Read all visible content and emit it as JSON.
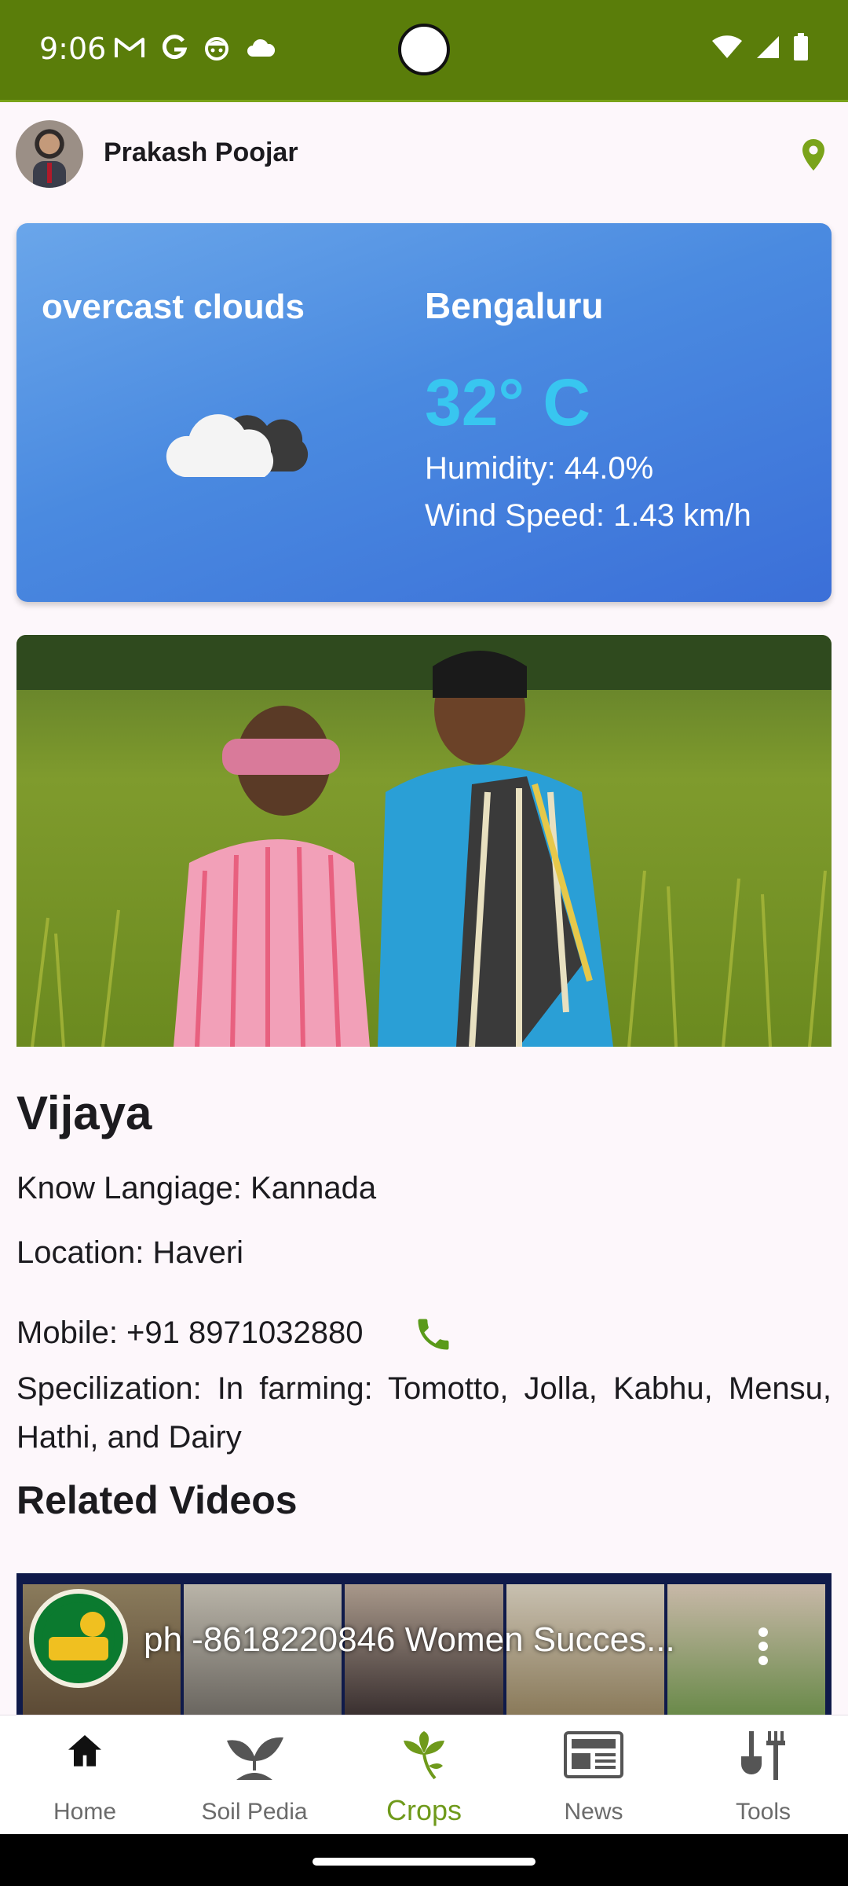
{
  "status_bar": {
    "time": "9:06",
    "left_icons": [
      "gmail-icon",
      "google-icon",
      "face-icon",
      "cloud-icon"
    ],
    "right_icons": [
      "wifi-icon",
      "signal-icon",
      "battery-icon"
    ]
  },
  "header": {
    "user_name": "Prakash Poojar",
    "location_icon": "location-pin-icon"
  },
  "weather": {
    "description": "overcast clouds",
    "city": "Bengaluru",
    "temperature": "32° C",
    "humidity": "Humidity: 44.0%",
    "wind_speed": "Wind Speed: 1.43 km/h",
    "icon": "cloud-icon"
  },
  "profile": {
    "name": "Vijaya",
    "language": "Know Langiage: Kannada",
    "location": "Location: Haveri",
    "mobile": "Mobile: +91 8971032880",
    "specialization": "Specilization: In farming: Tomotto, Jolla, Kabhu, Mensu, Hathi, and Dairy"
  },
  "related_videos": {
    "title": "Related Videos",
    "videos": [
      {
        "title": "ph -8618220846 Women Succes..."
      }
    ]
  },
  "bottom_nav": {
    "items": [
      {
        "label": "Home",
        "icon": "home-icon",
        "active": false
      },
      {
        "label": "Soil Pedia",
        "icon": "sprout-icon",
        "active": false
      },
      {
        "label": "Crops",
        "icon": "crops-icon",
        "active": true
      },
      {
        "label": "News",
        "icon": "newspaper-icon",
        "active": false
      },
      {
        "label": "Tools",
        "icon": "tools-icon",
        "active": false
      }
    ]
  },
  "colors": {
    "status_bar": "#5a7d0a",
    "accent_green": "#6f9a1b",
    "temperature": "#38c6f0",
    "weather_card_start": "#6aa6ea",
    "weather_card_end": "#3b6fd8"
  }
}
